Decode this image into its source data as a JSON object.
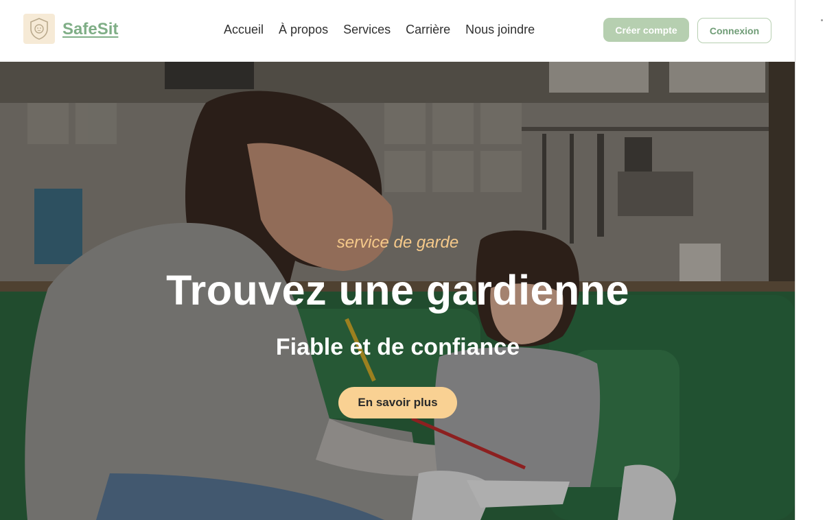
{
  "brand": {
    "name": "SafeSit",
    "logo_icon": "shield-child-icon"
  },
  "nav": {
    "items": [
      {
        "label": "Accueil"
      },
      {
        "label": "À propos"
      },
      {
        "label": "Services"
      },
      {
        "label": "Carrière"
      },
      {
        "label": "Nous joindre"
      }
    ]
  },
  "actions": {
    "signup_label": "Créer compte",
    "login_label": "Connexion"
  },
  "hero": {
    "eyebrow": "service de garde",
    "headline": "Trouvez une gardienne",
    "subheadline": "Fiable et de confiance",
    "cta_label": "En savoir plus",
    "image": "photo-woman-and-child-drawing-on-green-sofa"
  },
  "colors": {
    "brand_green": "#7fae86",
    "button_green": "#b6cfb0",
    "accent_peach": "#f9d193",
    "eyebrow_orange": "#f5c98a"
  }
}
